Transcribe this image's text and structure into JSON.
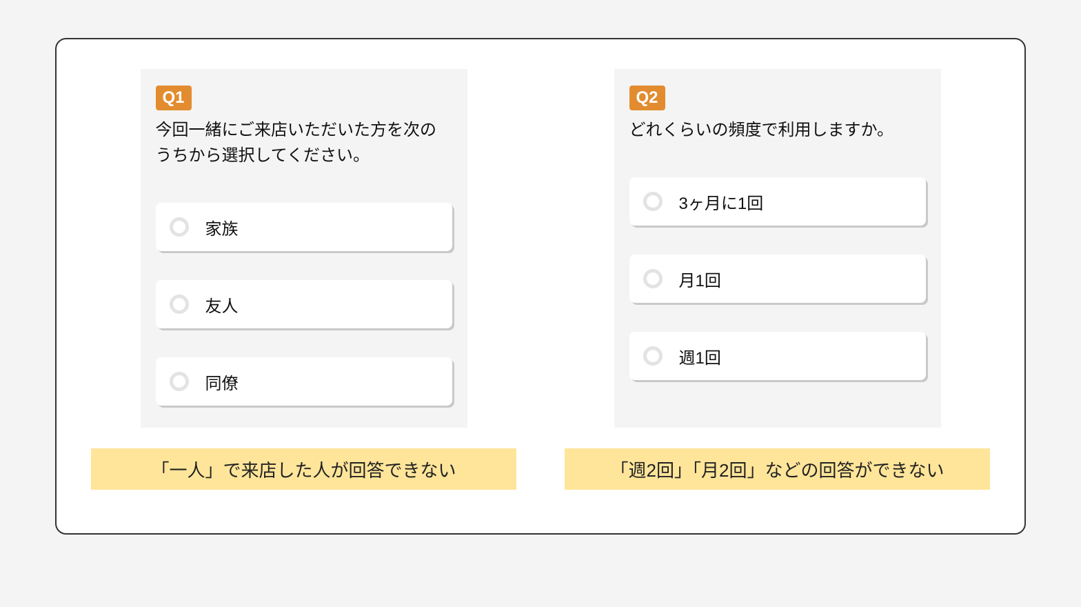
{
  "questions": [
    {
      "badge": "Q1",
      "text": "今回一緒にご来店いただいた方を次のうちから選択してください。",
      "options": [
        "家族",
        "友人",
        "同僚"
      ],
      "annotation": "「一人」で来店した人が回答できない"
    },
    {
      "badge": "Q2",
      "text": "どれくらいの頻度で利用しますか。",
      "options": [
        "3ヶ月に1回",
        "月1回",
        "週1回"
      ],
      "annotation": "「週2回」「月2回」などの回答ができない"
    }
  ],
  "colors": {
    "badge_bg": "#e28c2f",
    "annotation_bg": "#ffe59a",
    "card_bg": "#f4f4f4",
    "option_bg": "#ffffff"
  }
}
